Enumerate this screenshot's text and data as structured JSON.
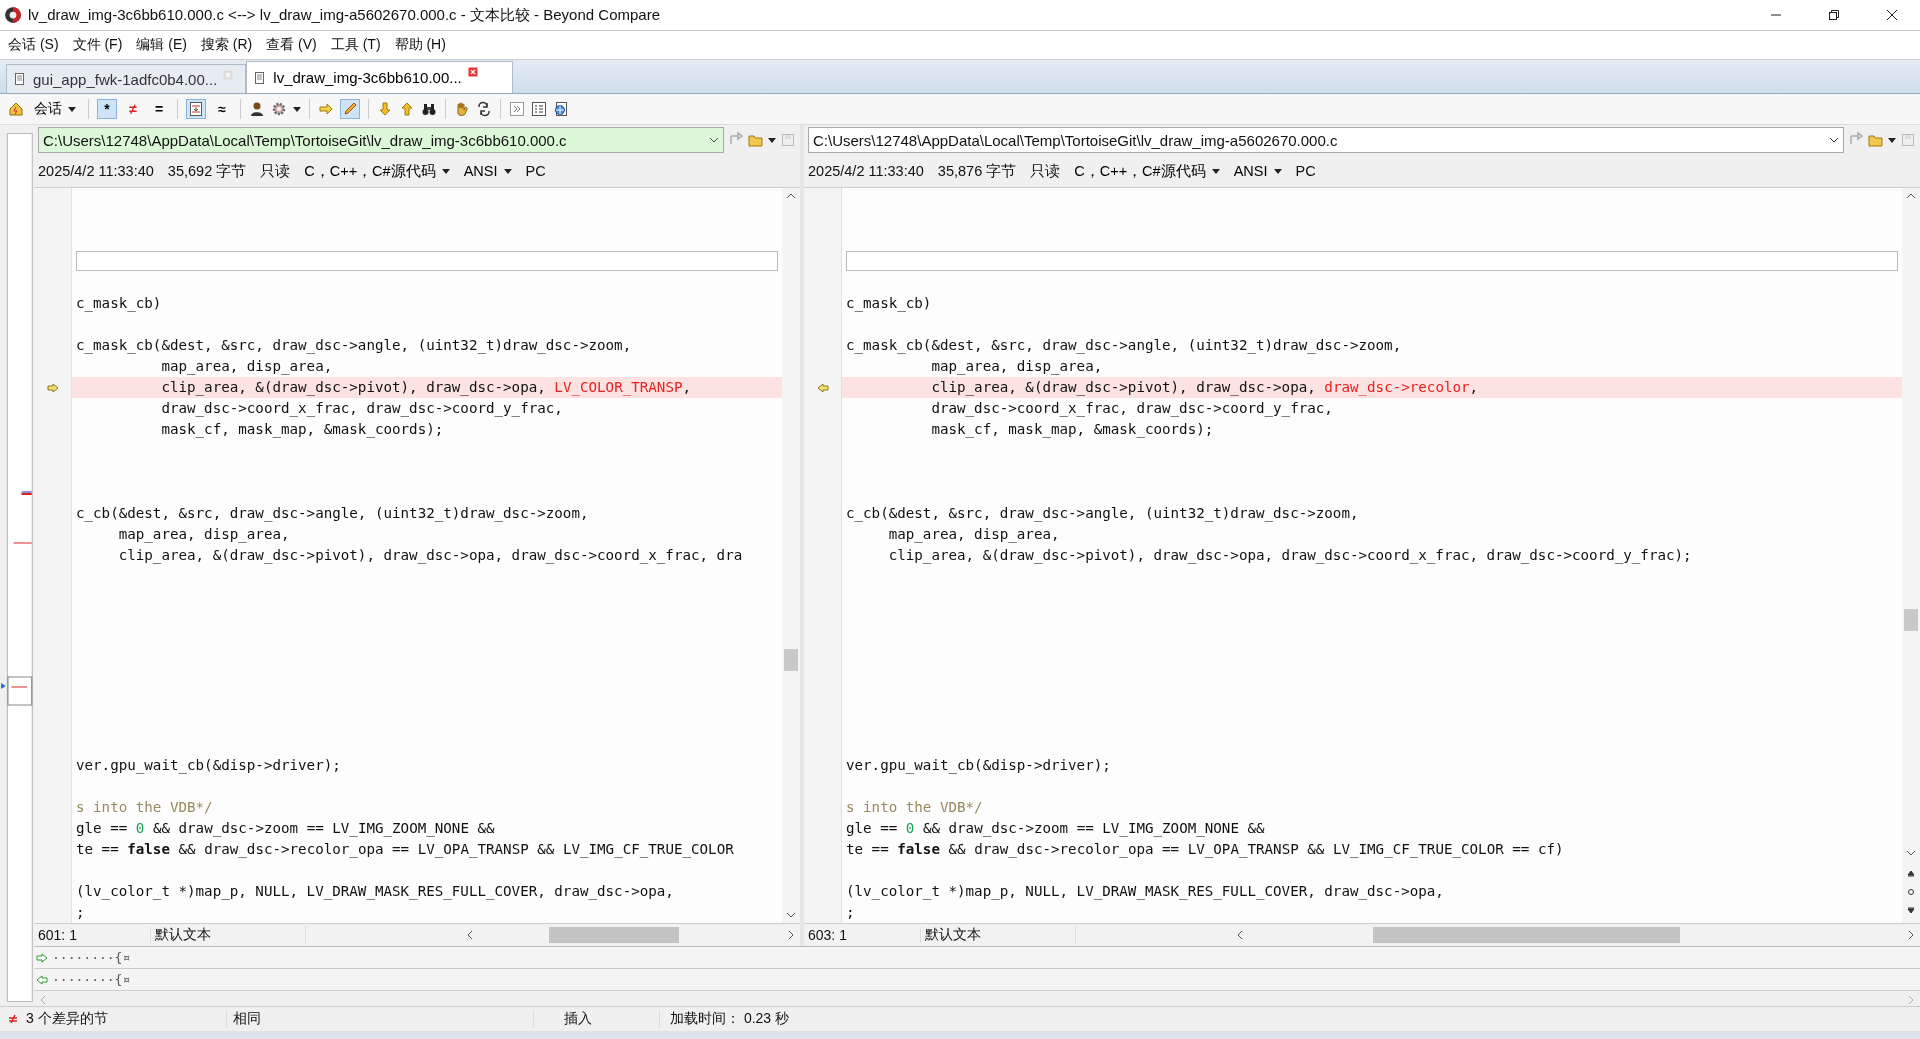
{
  "window": {
    "title": "lv_draw_img-3c6bb610.000.c <--> lv_draw_img-a5602670.000.c - 文本比较 - Beyond Compare"
  },
  "menu": [
    "会话 (S)",
    "文件 (F)",
    "编辑 (E)",
    "搜索 (R)",
    "查看 (V)",
    "工具 (T)",
    "帮助 (H)"
  ],
  "tabs": [
    {
      "label": "gui_app_fwk-1adfc0b4.00...",
      "selected": false
    },
    {
      "label": "lv_draw_img-3c6bb610.00...",
      "selected": true
    }
  ],
  "toolbar": {
    "session_label": "会话",
    "glyph_buttons": [
      {
        "glyph": "*",
        "pressed": true
      },
      {
        "glyph": "≠",
        "pressed": false
      },
      {
        "glyph": "=",
        "pressed": false
      }
    ],
    "context_pressed": true,
    "approx_glyph": "≈",
    "edit_pressed": true
  },
  "panes": [
    {
      "path": "C:\\Users\\12748\\AppData\\Local\\Temp\\TortoiseGit\\lv_draw_img-3c6bb610.000.c",
      "path_highlighted": true,
      "info": {
        "modified": "2025/4/2 11:33:40",
        "size": "35,692 字节",
        "readonly": "只读",
        "format": "C，C++，C#源代码",
        "encoding": "ANSI",
        "line_ending": "PC"
      },
      "lines": [
        {
          "kind": "blank"
        },
        {
          "kind": "blank"
        },
        {
          "kind": "blank"
        },
        {
          "kind": "gap"
        },
        {
          "kind": "blank"
        },
        {
          "kind": "code",
          "changed": false,
          "parts": [
            {
              "kind": "plain",
              "text": "c_mask_cb)"
            }
          ]
        },
        {
          "kind": "blank"
        },
        {
          "kind": "code",
          "changed": false,
          "parts": [
            {
              "kind": "plain",
              "text": "c_mask_cb(&dest, &src, draw_dsc->angle, (uint32_t)draw_dsc->zoom,"
            }
          ]
        },
        {
          "kind": "code",
          "changed": false,
          "parts": [
            {
              "kind": "plain",
              "text": "          map_area, disp_area,"
            }
          ]
        },
        {
          "kind": "code",
          "changed": true,
          "parts": [
            {
              "kind": "plain",
              "text": "          clip_area, &(draw_dsc->pivot), draw_dsc->opa, "
            },
            {
              "kind": "diff",
              "text": "LV_COLOR_TRANSP"
            },
            {
              "kind": "plain",
              "text": ","
            }
          ]
        },
        {
          "kind": "code",
          "changed": false,
          "parts": [
            {
              "kind": "plain",
              "text": "          draw_dsc->coord_x_frac, draw_dsc->coord_y_frac,"
            }
          ]
        },
        {
          "kind": "code",
          "changed": false,
          "parts": [
            {
              "kind": "plain",
              "text": "          mask_cf, mask_map, &mask_coords);"
            }
          ]
        },
        {
          "kind": "blank"
        },
        {
          "kind": "blank"
        },
        {
          "kind": "blank"
        },
        {
          "kind": "code",
          "changed": false,
          "parts": [
            {
              "kind": "plain",
              "text": "c_cb(&dest, &src, draw_dsc->angle, (uint32_t)draw_dsc->zoom,"
            }
          ]
        },
        {
          "kind": "code",
          "changed": false,
          "parts": [
            {
              "kind": "plain",
              "text": "     map_area, disp_area,"
            }
          ]
        },
        {
          "kind": "code",
          "changed": false,
          "parts": [
            {
              "kind": "plain",
              "text": "     clip_area, &(draw_dsc->pivot), draw_dsc->opa, draw_dsc->coord_x_frac, dra"
            }
          ]
        },
        {
          "kind": "blank"
        },
        {
          "kind": "blank"
        },
        {
          "kind": "blank"
        },
        {
          "kind": "blank"
        },
        {
          "kind": "blank"
        },
        {
          "kind": "blank"
        },
        {
          "kind": "blank"
        },
        {
          "kind": "blank"
        },
        {
          "kind": "blank"
        },
        {
          "kind": "code",
          "changed": false,
          "parts": [
            {
              "kind": "plain",
              "text": "ver.gpu_wait_cb(&disp->driver);"
            }
          ]
        },
        {
          "kind": "blank"
        },
        {
          "kind": "code",
          "changed": false,
          "parts": [
            {
              "kind": "comment",
              "text": "s into the VDB*/"
            }
          ]
        },
        {
          "kind": "code",
          "changed": false,
          "parts": [
            {
              "kind": "plain",
              "text": "gle == "
            },
            {
              "kind": "number",
              "text": "0"
            },
            {
              "kind": "plain",
              "text": " && draw_dsc->zoom == LV_IMG_ZOOM_NONE &&"
            }
          ]
        },
        {
          "kind": "code",
          "changed": false,
          "parts": [
            {
              "kind": "plain",
              "text": "te == "
            },
            {
              "kind": "keyword",
              "text": "false"
            },
            {
              "kind": "plain",
              "text": " && draw_dsc->recolor_opa == LV_OPA_TRANSP && LV_IMG_CF_TRUE_COLOR"
            }
          ]
        },
        {
          "kind": "blank"
        },
        {
          "kind": "code",
          "changed": false,
          "parts": [
            {
              "kind": "plain",
              "text": "(lv_color_t *)map_p, NULL, LV_DRAW_MASK_RES_FULL_COVER, draw_dsc->opa,"
            }
          ]
        },
        {
          "kind": "code",
          "changed": false,
          "parts": [
            {
              "kind": "plain",
              "text": ";"
            }
          ]
        }
      ],
      "status": {
        "position": "601: 1",
        "syntax": "默认文本"
      }
    },
    {
      "path": "C:\\Users\\12748\\AppData\\Local\\Temp\\TortoiseGit\\lv_draw_img-a5602670.000.c",
      "path_highlighted": false,
      "info": {
        "modified": "2025/4/2 11:33:40",
        "size": "35,876 字节",
        "readonly": "只读",
        "format": "C，C++，C#源代码",
        "encoding": "ANSI",
        "line_ending": "PC"
      },
      "lines": [
        {
          "kind": "blank"
        },
        {
          "kind": "blank"
        },
        {
          "kind": "blank"
        },
        {
          "kind": "gap"
        },
        {
          "kind": "blank"
        },
        {
          "kind": "code",
          "changed": false,
          "parts": [
            {
              "kind": "plain",
              "text": "c_mask_cb)"
            }
          ]
        },
        {
          "kind": "blank"
        },
        {
          "kind": "code",
          "changed": false,
          "parts": [
            {
              "kind": "plain",
              "text": "c_mask_cb(&dest, &src, draw_dsc->angle, (uint32_t)draw_dsc->zoom,"
            }
          ]
        },
        {
          "kind": "code",
          "changed": false,
          "parts": [
            {
              "kind": "plain",
              "text": "          map_area, disp_area,"
            }
          ]
        },
        {
          "kind": "code",
          "changed": true,
          "parts": [
            {
              "kind": "plain",
              "text": "          clip_area, &(draw_dsc->pivot), draw_dsc->opa, "
            },
            {
              "kind": "diff",
              "text": "draw_dsc->recolor"
            },
            {
              "kind": "plain",
              "text": ","
            }
          ]
        },
        {
          "kind": "code",
          "changed": false,
          "parts": [
            {
              "kind": "plain",
              "text": "          draw_dsc->coord_x_frac, draw_dsc->coord_y_frac,"
            }
          ]
        },
        {
          "kind": "code",
          "changed": false,
          "parts": [
            {
              "kind": "plain",
              "text": "          mask_cf, mask_map, &mask_coords);"
            }
          ]
        },
        {
          "kind": "blank"
        },
        {
          "kind": "blank"
        },
        {
          "kind": "blank"
        },
        {
          "kind": "code",
          "changed": false,
          "parts": [
            {
              "kind": "plain",
              "text": "c_cb(&dest, &src, draw_dsc->angle, (uint32_t)draw_dsc->zoom,"
            }
          ]
        },
        {
          "kind": "code",
          "changed": false,
          "parts": [
            {
              "kind": "plain",
              "text": "     map_area, disp_area,"
            }
          ]
        },
        {
          "kind": "code",
          "changed": false,
          "parts": [
            {
              "kind": "plain",
              "text": "     clip_area, &(draw_dsc->pivot), draw_dsc->opa, draw_dsc->coord_x_frac, draw_dsc->coord_y_frac);"
            }
          ]
        },
        {
          "kind": "blank"
        },
        {
          "kind": "blank"
        },
        {
          "kind": "blank"
        },
        {
          "kind": "blank"
        },
        {
          "kind": "blank"
        },
        {
          "kind": "blank"
        },
        {
          "kind": "blank"
        },
        {
          "kind": "blank"
        },
        {
          "kind": "blank"
        },
        {
          "kind": "code",
          "changed": false,
          "parts": [
            {
              "kind": "plain",
              "text": "ver.gpu_wait_cb(&disp->driver);"
            }
          ]
        },
        {
          "kind": "blank"
        },
        {
          "kind": "code",
          "changed": false,
          "parts": [
            {
              "kind": "comment",
              "text": "s into the VDB*/"
            }
          ]
        },
        {
          "kind": "code",
          "changed": false,
          "parts": [
            {
              "kind": "plain",
              "text": "gle == "
            },
            {
              "kind": "number",
              "text": "0"
            },
            {
              "kind": "plain",
              "text": " && draw_dsc->zoom == LV_IMG_ZOOM_NONE &&"
            }
          ]
        },
        {
          "kind": "code",
          "changed": false,
          "parts": [
            {
              "kind": "plain",
              "text": "te == "
            },
            {
              "kind": "keyword",
              "text": "false"
            },
            {
              "kind": "plain",
              "text": " && draw_dsc->recolor_opa == LV_OPA_TRANSP && LV_IMG_CF_TRUE_COLOR == cf)"
            }
          ]
        },
        {
          "kind": "blank"
        },
        {
          "kind": "code",
          "changed": false,
          "parts": [
            {
              "kind": "plain",
              "text": "(lv_color_t *)map_p, NULL, LV_DRAW_MASK_RES_FULL_COVER, draw_dsc->opa,"
            }
          ]
        },
        {
          "kind": "code",
          "changed": false,
          "parts": [
            {
              "kind": "plain",
              "text": ";"
            }
          ]
        }
      ],
      "status": {
        "position": "603: 1",
        "syntax": "默认文本"
      }
    }
  ],
  "compare_lines": [
    {
      "text": "········{¤"
    },
    {
      "text": "········{¤"
    }
  ],
  "status_bar": {
    "differences": "3 个差异的节",
    "comparison": "相同",
    "mode": "插入",
    "load_time": "加载时间： 0.23 秒"
  }
}
